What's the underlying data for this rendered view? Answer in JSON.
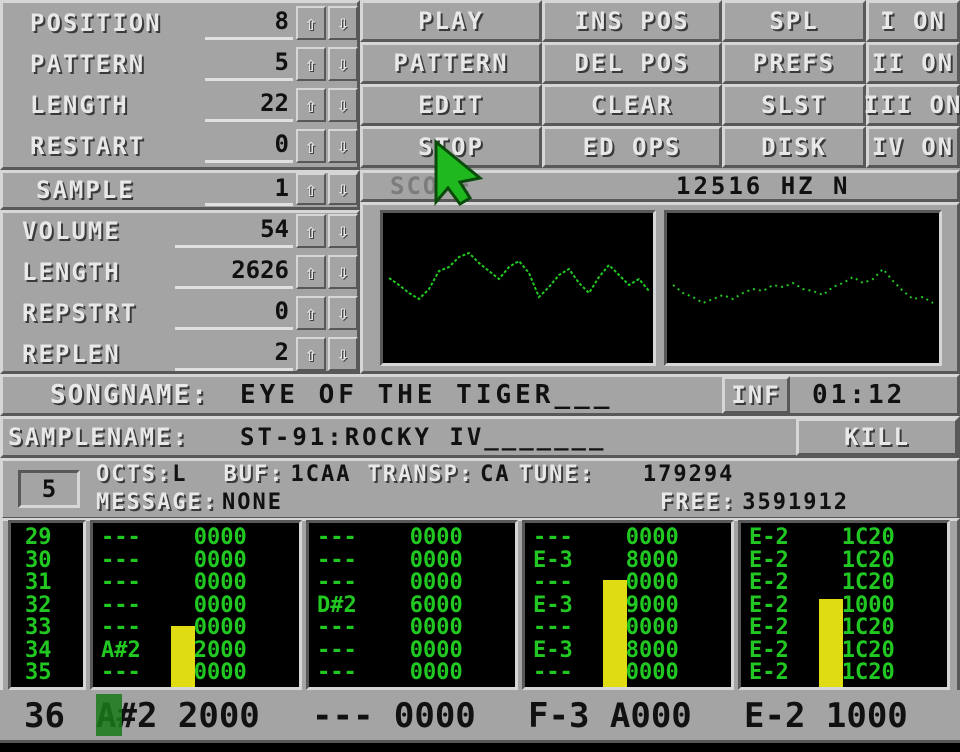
{
  "song_controls": [
    {
      "label": "POSITION",
      "value": "8"
    },
    {
      "label": "PATTERN",
      "value": "5"
    },
    {
      "label": "LENGTH",
      "value": "22"
    },
    {
      "label": "RESTART",
      "value": "0"
    }
  ],
  "transport": {
    "col1": [
      "PLAY",
      "PATTERN",
      "EDIT",
      "STOP"
    ],
    "col2": [
      "INS POS",
      "DEL POS",
      "CLEAR",
      "ED OPS"
    ],
    "col3": [
      "SPL",
      "PREFS",
      "SLST",
      "DISK"
    ],
    "channels": [
      "I ON",
      "II ON",
      "III ON",
      "IV ON"
    ]
  },
  "sample": {
    "label": "SAMPLE",
    "value": "1"
  },
  "sample_controls": [
    {
      "label": "VOLUME",
      "value": "54"
    },
    {
      "label": "LENGTH",
      "value": "2626"
    },
    {
      "label": "REPSTRT",
      "value": "0"
    },
    {
      "label": "REPLEN",
      "value": "2"
    }
  ],
  "scope": {
    "label": "SCOPE",
    "freq": "12516 HZ N"
  },
  "song": {
    "label": "SONGNAME:",
    "name": "EYE OF THE TIGER___",
    "inf": "INF",
    "time": "01:12"
  },
  "samplename": {
    "label": "SAMPLENAME:",
    "name": "ST-91:ROCKY IV_______",
    "kill": "KILL"
  },
  "status": {
    "box": "5",
    "octs_label": "OCTS:",
    "octs": "L",
    "buf_label": "BUF:",
    "buf": "1CAA",
    "transp_label": "TRANSP:",
    "transp": "CA",
    "tune_label": "TUNE:",
    "tune": "179294",
    "msg_label": "MESSAGE:",
    "msg": "NONE",
    "free_label": "FREE:",
    "free": "3591912"
  },
  "rows": [
    "29",
    "30",
    "31",
    "32",
    "33",
    "34",
    "35"
  ],
  "channels": [
    [
      "---    0000",
      "---    0000",
      "---    0000",
      "---    0000",
      "---    0000",
      "A#2    2000",
      "---    0000"
    ],
    [
      "---    0000",
      "---    0000",
      "---    0000",
      "D#2    6000",
      "---    0000",
      "---    0000",
      "---    0000"
    ],
    [
      "---    0000",
      "E-3    8000",
      "---    0000",
      "E-3    9000",
      "---    0000",
      "E-3    8000",
      "---    0000"
    ],
    [
      "E-2    1C20",
      "E-2    1C20",
      "E-2    1C20",
      "E-2    1000",
      "E-2    1C20",
      "E-2    1C20",
      "E-2    1C20"
    ]
  ],
  "vu_levels": [
    0.38,
    0,
    0.67,
    0.55
  ],
  "current_row": {
    "num": "36",
    "cells": [
      "A#2 2000",
      "--- 0000",
      "F-3 A000",
      "E-2 1000"
    ]
  },
  "colors": {
    "panel": "#a4a4a4",
    "text": "#22c822",
    "vu": "#e0dc14",
    "cursor": "#1a7a1a"
  }
}
